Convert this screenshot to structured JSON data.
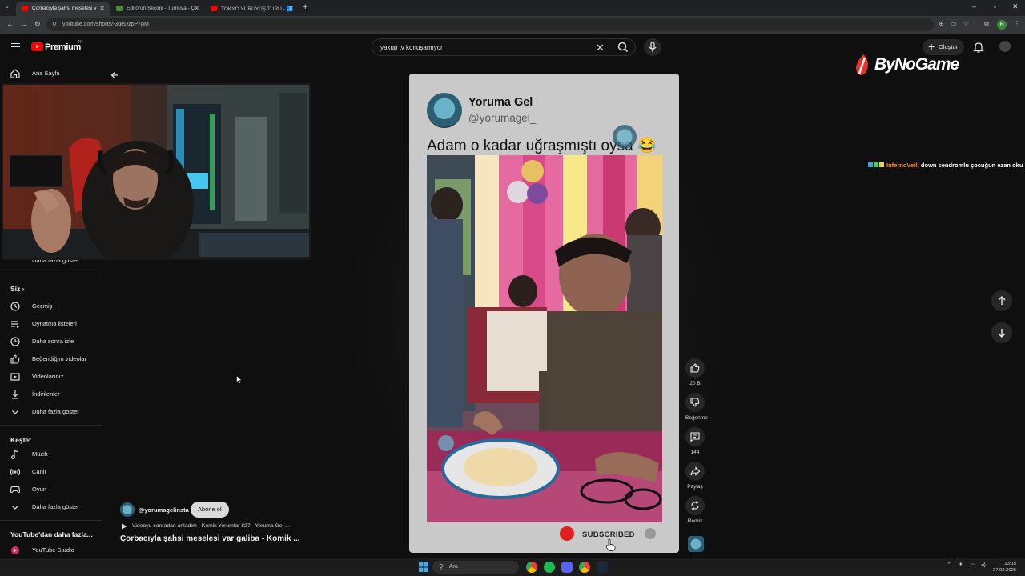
{
  "browser": {
    "tabs": [
      {
        "title": "Çorbacıyla şahsi meselesi v",
        "active": true
      },
      {
        "title": "Editörün Seçimi - Turnuva - Ç",
        "active": false
      },
      {
        "title": "TOKYO YÜRÜYÜŞ TURU - 🗾",
        "active": false
      }
    ],
    "url": "youtube.com/shorts/-3qeDzpP7pM"
  },
  "header": {
    "brand": "Premium",
    "brand_sup": "TR",
    "search_query": "yakup tv konuşamıyor",
    "create_label": "Oluştur"
  },
  "sidebar": {
    "home_label": "Ana Sayfa",
    "show_more_top": "Daha fazla göster",
    "you_heading": "Siz",
    "you_items": [
      {
        "label": "Geçmiş",
        "icon": "history-icon"
      },
      {
        "label": "Oynatma listeleri",
        "icon": "playlists-icon"
      },
      {
        "label": "Daha sonra izle",
        "icon": "watch-later-icon"
      },
      {
        "label": "Beğendiğim videolar",
        "icon": "liked-icon"
      },
      {
        "label": "Videolarınız",
        "icon": "your-videos-icon"
      },
      {
        "label": "İndirilenler",
        "icon": "download-icon"
      },
      {
        "label": "Daha fazla göster",
        "icon": "chevron-down-icon"
      }
    ],
    "explore_heading": "Keşfet",
    "explore_items": [
      {
        "label": "Müzik",
        "icon": "music-icon"
      },
      {
        "label": "Canlı",
        "icon": "live-icon"
      },
      {
        "label": "Oyun",
        "icon": "gaming-icon"
      },
      {
        "label": "Daha fazla göster",
        "icon": "chevron-down-icon"
      }
    ],
    "more_heading": "YouTube'dan daha fazla...",
    "studio_label": "YouTube Studio"
  },
  "short": {
    "channel_name": "Yoruma Gel",
    "channel_handle": "@yorumagel_",
    "caption": "Adam o kadar uğraşmıştı oysa 😂",
    "subscribed_label": "SUBSCRIBED"
  },
  "actions": {
    "like_count": "20 B",
    "dislike_label": "Beğenme",
    "comment_count": "144",
    "share_label": "Paylaş",
    "remix_label": "Remix"
  },
  "bottom_info": {
    "channel": "@yorumagelinsta",
    "subscribe_label": "Abone ol",
    "linked_video": "Videoyu sonradan anladım - Komik Yorumlar 827 - Yoruma Gel ...",
    "title": "Çorbacıyla şahsi meselesi var galiba - Komik ..."
  },
  "overlay": {
    "logo_text": "ByNoGame",
    "chat_user": "InfernoVeil",
    "chat_message": ": down sendromlu çocuğun ezan oku",
    "chat_user_color": "#ff8c1a"
  },
  "taskbar": {
    "search_placeholder": "Ara",
    "time": "23:15",
    "date": "27.02.2026"
  }
}
